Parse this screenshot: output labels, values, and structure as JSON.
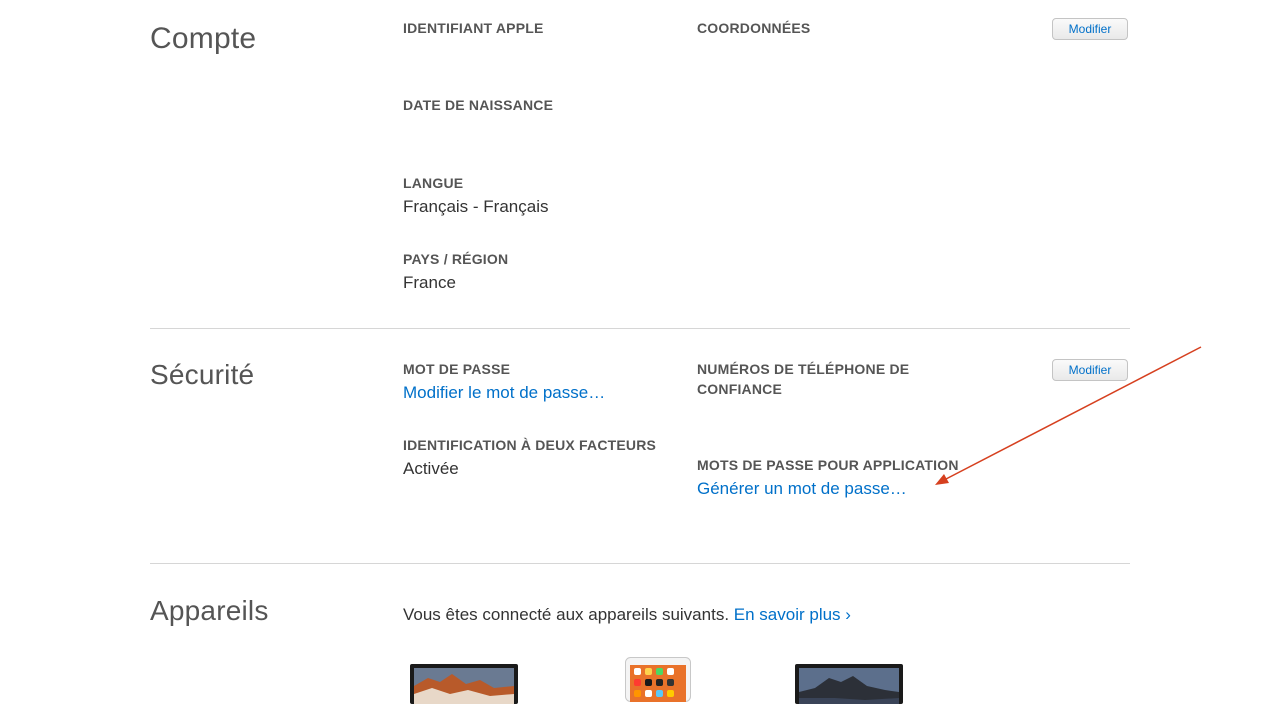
{
  "compte": {
    "title": "Compte",
    "apple_id_label": "IDENTIFIANT APPLE",
    "contact_label": "COORDONNÉES",
    "edit_button": "Modifier",
    "birthdate_label": "DATE DE NAISSANCE",
    "language_label": "LANGUE",
    "language_value": "Français - Français",
    "country_label": "PAYS / RÉGION",
    "country_value": "France"
  },
  "securite": {
    "title": "Sécurité",
    "password_label": "MOT DE PASSE",
    "password_link": "Modifier le mot de passe…",
    "trusted_phone_label": "NUMÉROS DE TÉLÉPHONE DE CONFIANCE",
    "edit_button": "Modifier",
    "two_factor_label": "IDENTIFICATION À DEUX FACTEURS",
    "two_factor_value": "Activée",
    "app_passwords_label": "MOTS DE PASSE POUR APPLICATION",
    "app_passwords_link": "Générer un mot de passe…"
  },
  "appareils": {
    "title": "Appareils",
    "intro_text": "Vous êtes connecté aux appareils suivants.",
    "learn_more_link": "En savoir plus ›"
  },
  "annotation": {
    "arrow_color": "#d6401f"
  },
  "colors": {
    "link": "#0070c9",
    "label": "#555555",
    "divider": "#d6d6d6"
  }
}
